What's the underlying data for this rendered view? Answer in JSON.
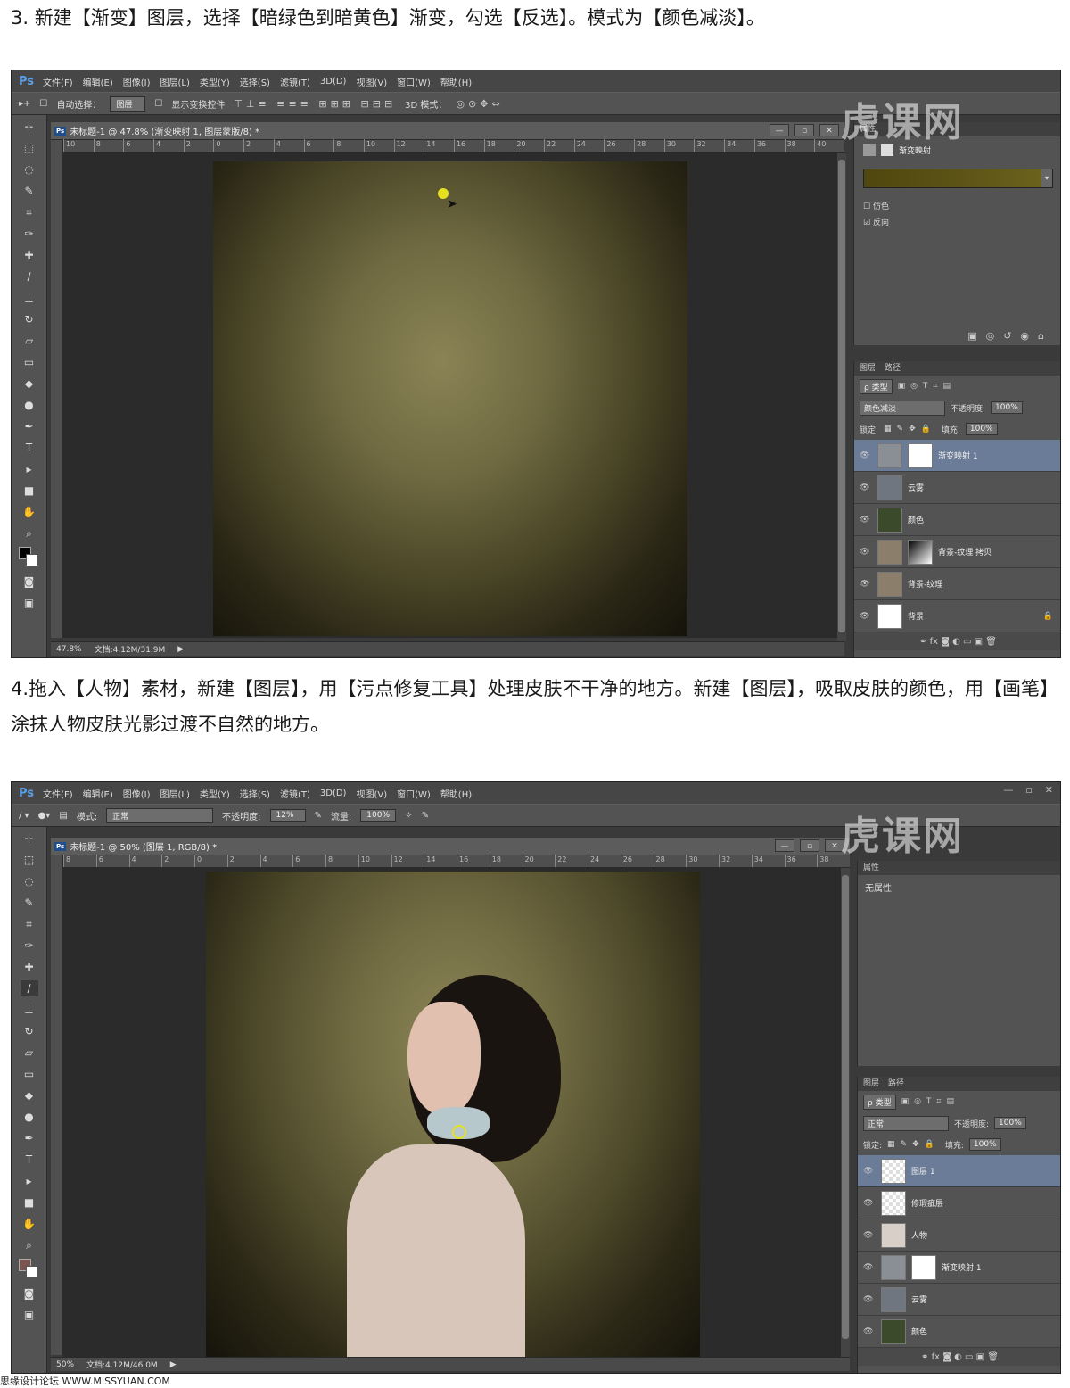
{
  "steps": {
    "step3": "3. 新建【渐变】图层，选择【暗绿色到暗黄色】渐变，勾选【反选】。模式为【颜色减淡】。",
    "step4": "4.拖入【人物】素材，新建【图层】，用【污点修复工具】处理皮肤不干净的地方。新建【图层】，吸取皮肤的颜色，用【画笔】涂抹人物皮肤光影过渡不自然的地方。"
  },
  "app": {
    "logo": "Ps",
    "menus": [
      "文件(F)",
      "编辑(E)",
      "图像(I)",
      "图层(L)",
      "类型(Y)",
      "选择(S)",
      "滤镜(T)",
      "3D(D)",
      "视图(V)",
      "窗口(W)",
      "帮助(H)"
    ],
    "watermark": "虎课网"
  },
  "shot1": {
    "options": {
      "auto_select": "自动选择：",
      "target": "图层",
      "show_transform": "显示变换控件",
      "mode3d": "3D 模式："
    },
    "doc_tab": "未标题-1 @ 47.8% (渐变映射 1, 图层蒙版/8) *",
    "ruler_h": [
      "10",
      "8",
      "6",
      "4",
      "2",
      "0",
      "2",
      "4",
      "6",
      "8",
      "10",
      "12",
      "14",
      "16",
      "18",
      "20",
      "22",
      "24",
      "26",
      "28",
      "30",
      "32",
      "34",
      "36",
      "38",
      "40"
    ],
    "status": {
      "zoom": "47.8%",
      "doc": "文档:4.12M/31.9M"
    },
    "properties": {
      "header": "属性",
      "title": "渐变映射",
      "gradient_color": "#5b5215",
      "dither": "仿色",
      "reverse": "反向"
    },
    "layers_panel": {
      "tabs": [
        "图层",
        "路径"
      ],
      "filter": "ρ 类型",
      "blend_mode": "颜色减淡",
      "opacity_label": "不透明度:",
      "opacity": "100%",
      "lock_label": "锁定:",
      "fill_label": "填充:",
      "fill": "100%",
      "layers": [
        {
          "name": "渐变映射 1",
          "selected": true,
          "thumb": "#8a8f96",
          "mask": true
        },
        {
          "name": "云雾",
          "selected": false,
          "thumb": "#6f7680",
          "mask": false
        },
        {
          "name": "颜色",
          "selected": false,
          "thumb": "#3c4a2c",
          "mask": false
        },
        {
          "name": "背景-纹理 拷贝",
          "selected": false,
          "thumb": "#8b7e6a",
          "mask": true
        },
        {
          "name": "背景-纹理",
          "selected": false,
          "thumb": "#8b7e6a",
          "mask": false
        },
        {
          "name": "背景",
          "selected": false,
          "thumb": "#ffffff",
          "mask": false
        }
      ]
    }
  },
  "shot2": {
    "options": {
      "mode_label": "模式:",
      "mode": "正常",
      "opacity_label": "不透明度:",
      "opacity": "12%",
      "flow_label": "流量:",
      "flow": "100%"
    },
    "doc_tab": "未标题-1 @ 50% (图层 1, RGB/8) *",
    "ruler_h": [
      "8",
      "6",
      "4",
      "2",
      "0",
      "2",
      "4",
      "6",
      "8",
      "10",
      "12",
      "14",
      "16",
      "18",
      "20",
      "22",
      "24",
      "26",
      "28",
      "30",
      "32",
      "34",
      "36",
      "38"
    ],
    "status": {
      "zoom": "50%",
      "doc": "文档:4.12M/46.0M"
    },
    "properties": {
      "header": "属性",
      "none": "无属性"
    },
    "layers_panel": {
      "tabs": [
        "图层",
        "路径"
      ],
      "filter": "ρ 类型",
      "blend_mode": "正常",
      "opacity_label": "不透明度:",
      "opacity": "100%",
      "lock_label": "锁定:",
      "fill_label": "填充:",
      "fill": "100%",
      "layers": [
        {
          "name": "图层 1",
          "selected": true,
          "thumb": "checker",
          "mask": false
        },
        {
          "name": "修瑕疵层",
          "selected": false,
          "thumb": "checker",
          "mask": false
        },
        {
          "name": "人物",
          "selected": false,
          "thumb": "#d8d0c8",
          "mask": false
        },
        {
          "name": "渐变映射 1",
          "selected": false,
          "thumb": "#8a8f96",
          "mask": true
        },
        {
          "name": "云雾",
          "selected": false,
          "thumb": "#6f7680",
          "mask": false
        },
        {
          "name": "颜色",
          "selected": false,
          "thumb": "#3c4a2c",
          "mask": false
        }
      ]
    }
  },
  "footer": "思缘设计论坛 WWW.MISSYUAN.COM"
}
